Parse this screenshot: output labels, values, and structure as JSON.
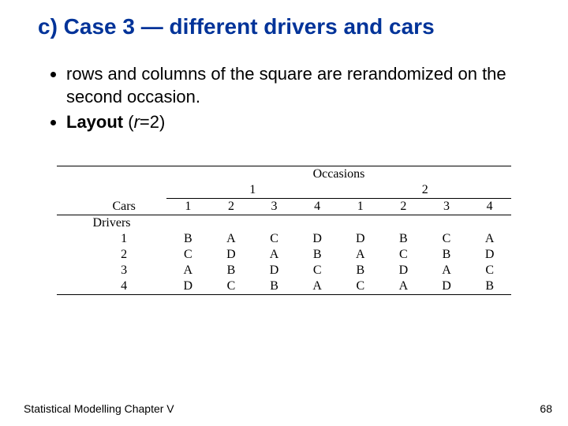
{
  "title": "c)  Case 3 — different drivers and cars",
  "bullets": {
    "item1": "rows and columns of the square are rerandomized on the second occasion.",
    "layout_word": "Layout",
    "layout_paren_open": " (",
    "layout_var": "r",
    "layout_eq": "=2)"
  },
  "table": {
    "top_header": "Occasions",
    "occ1": "1",
    "occ2": "2",
    "cars_label": "Cars",
    "cars_cols": [
      "1",
      "2",
      "3",
      "4",
      "1",
      "2",
      "3",
      "4"
    ],
    "drivers_label": "Drivers",
    "rows": [
      {
        "d": "1",
        "o1": [
          "B",
          "A",
          "C",
          "D"
        ],
        "o2": [
          "D",
          "B",
          "C",
          "A"
        ]
      },
      {
        "d": "2",
        "o1": [
          "C",
          "D",
          "A",
          "B"
        ],
        "o2": [
          "A",
          "C",
          "B",
          "D"
        ]
      },
      {
        "d": "3",
        "o1": [
          "A",
          "B",
          "D",
          "C"
        ],
        "o2": [
          "B",
          "D",
          "A",
          "C"
        ]
      },
      {
        "d": "4",
        "o1": [
          "D",
          "C",
          "B",
          "A"
        ],
        "o2": [
          "C",
          "A",
          "D",
          "B"
        ]
      }
    ]
  },
  "footer": {
    "left": "Statistical Modelling   Chapter V",
    "right": "68"
  },
  "chart_data": {
    "type": "table",
    "title": "Latin-square layout, Case 3, r=2 occasions",
    "factors": {
      "rows": "Drivers",
      "cols": "Cars",
      "blocks": "Occasions"
    },
    "occasions": [
      {
        "occasion": 1,
        "grid": [
          [
            "B",
            "A",
            "C",
            "D"
          ],
          [
            "C",
            "D",
            "A",
            "B"
          ],
          [
            "A",
            "B",
            "D",
            "C"
          ],
          [
            "D",
            "C",
            "B",
            "A"
          ]
        ]
      },
      {
        "occasion": 2,
        "grid": [
          [
            "D",
            "B",
            "C",
            "A"
          ],
          [
            "A",
            "C",
            "B",
            "D"
          ],
          [
            "B",
            "D",
            "A",
            "C"
          ],
          [
            "C",
            "A",
            "D",
            "B"
          ]
        ]
      }
    ]
  }
}
